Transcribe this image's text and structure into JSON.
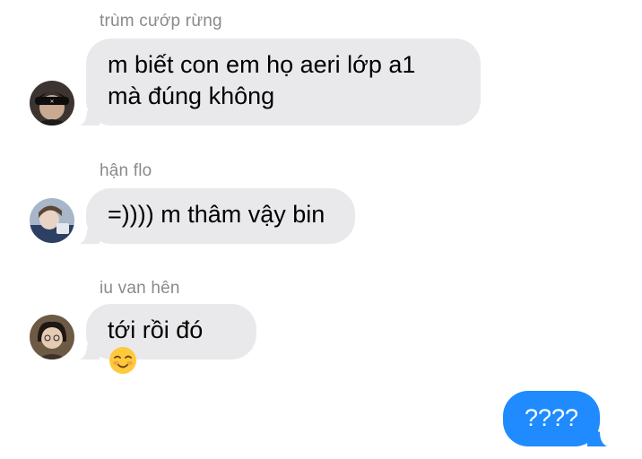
{
  "messages": [
    {
      "sender": "trùm cướp rừng",
      "text": "m biết con em họ aeri lớp a1 mà đúng không",
      "avatar_icon": "avatar-black-cap"
    },
    {
      "sender": "hận flo",
      "text": "=)))) m thâm vậy bin",
      "avatar_icon": "avatar-photo-blue"
    },
    {
      "sender": "iu van hên",
      "text": "tới rồi đó",
      "emoji_icon": "smiling-blush-emoji",
      "avatar_icon": "avatar-photo-girl"
    }
  ],
  "outgoing": {
    "text": "????"
  },
  "colors": {
    "incoming_bubble": "#e9e9eb",
    "outgoing_bubble": "#1f8bff",
    "sender_name": "#8a8a8e"
  }
}
